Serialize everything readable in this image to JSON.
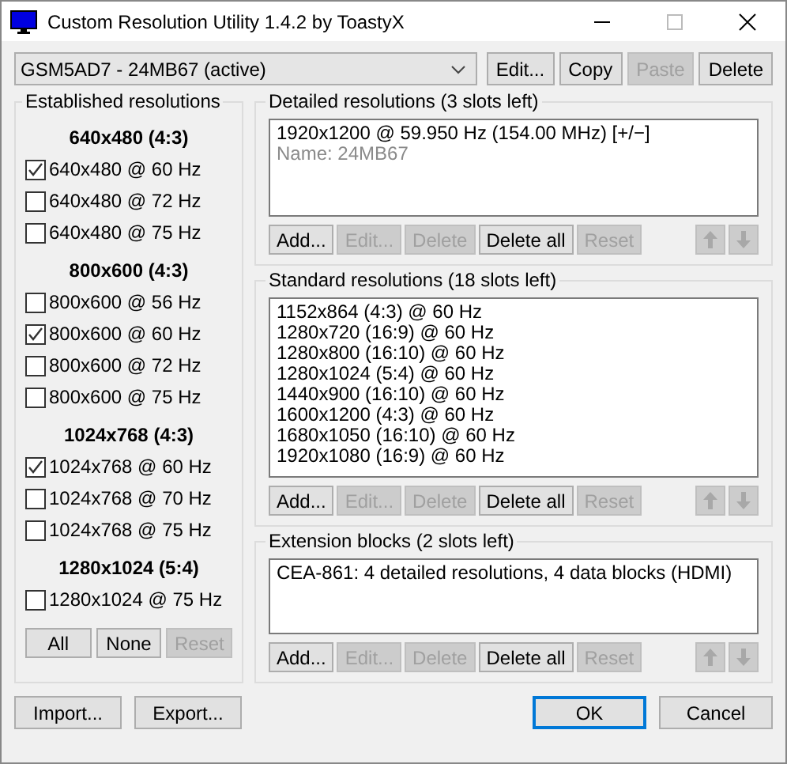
{
  "window": {
    "title": "Custom Resolution Utility 1.4.2 by ToastyX"
  },
  "device": {
    "value": "GSM5AD7 - 24MB67 (active)"
  },
  "device_buttons": [
    {
      "label": "Edit...",
      "disabled": false
    },
    {
      "label": "Copy",
      "disabled": false
    },
    {
      "label": "Paste",
      "disabled": true
    },
    {
      "label": "Delete",
      "disabled": false
    }
  ],
  "established": {
    "title": "Established resolutions",
    "groups": [
      {
        "heading": "640x480 (4:3)",
        "items": [
          {
            "label": "640x480 @ 60 Hz",
            "checked": true
          },
          {
            "label": "640x480 @ 72 Hz",
            "checked": false
          },
          {
            "label": "640x480 @ 75 Hz",
            "checked": false
          }
        ]
      },
      {
        "heading": "800x600 (4:3)",
        "items": [
          {
            "label": "800x600 @ 56 Hz",
            "checked": false
          },
          {
            "label": "800x600 @ 60 Hz",
            "checked": true
          },
          {
            "label": "800x600 @ 72 Hz",
            "checked": false
          },
          {
            "label": "800x600 @ 75 Hz",
            "checked": false
          }
        ]
      },
      {
        "heading": "1024x768 (4:3)",
        "items": [
          {
            "label": "1024x768 @ 60 Hz",
            "checked": true
          },
          {
            "label": "1024x768 @ 70 Hz",
            "checked": false
          },
          {
            "label": "1024x768 @ 75 Hz",
            "checked": false
          }
        ]
      },
      {
        "heading": "1280x1024 (5:4)",
        "items": [
          {
            "label": "1280x1024 @ 75 Hz",
            "checked": false
          }
        ]
      }
    ],
    "buttons": [
      {
        "label": "All",
        "disabled": false
      },
      {
        "label": "None",
        "disabled": false
      },
      {
        "label": "Reset",
        "disabled": true
      }
    ]
  },
  "sections": [
    {
      "title": "Detailed resolutions (3 slots left)",
      "lines": [
        {
          "text": "1920x1200 @ 59.950 Hz (154.00 MHz) [+/−]",
          "dim": false
        },
        {
          "text": "Name: 24MB67",
          "dim": true
        }
      ],
      "buttons": [
        {
          "label": "Add...",
          "disabled": false
        },
        {
          "label": "Edit...",
          "disabled": true
        },
        {
          "label": "Delete",
          "disabled": true
        },
        {
          "label": "Delete all",
          "disabled": false
        },
        {
          "label": "Reset",
          "disabled": true
        }
      ],
      "arrows": [
        {
          "kind": "up",
          "disabled": true
        },
        {
          "kind": "down",
          "disabled": true
        }
      ]
    },
    {
      "title": "Standard resolutions (18 slots left)",
      "lines": [
        {
          "text": "1152x864 (4:3) @ 60 Hz",
          "dim": false
        },
        {
          "text": "1280x720 (16:9) @ 60 Hz",
          "dim": false
        },
        {
          "text": "1280x800 (16:10) @ 60 Hz",
          "dim": false
        },
        {
          "text": "1280x1024 (5:4) @ 60 Hz",
          "dim": false
        },
        {
          "text": "1440x900 (16:10) @ 60 Hz",
          "dim": false
        },
        {
          "text": "1600x1200 (4:3) @ 60 Hz",
          "dim": false
        },
        {
          "text": "1680x1050 (16:10) @ 60 Hz",
          "dim": false
        },
        {
          "text": "1920x1080 (16:9) @ 60 Hz",
          "dim": false
        }
      ],
      "buttons": [
        {
          "label": "Add...",
          "disabled": false
        },
        {
          "label": "Edit...",
          "disabled": true
        },
        {
          "label": "Delete",
          "disabled": true
        },
        {
          "label": "Delete all",
          "disabled": false
        },
        {
          "label": "Reset",
          "disabled": true
        }
      ],
      "arrows": [
        {
          "kind": "up",
          "disabled": true
        },
        {
          "kind": "down",
          "disabled": true
        }
      ]
    },
    {
      "title": "Extension blocks (2 slots left)",
      "lines": [
        {
          "text": "CEA-861: 4 detailed resolutions, 4 data blocks (HDMI)",
          "dim": false
        }
      ],
      "buttons": [
        {
          "label": "Add...",
          "disabled": false
        },
        {
          "label": "Edit...",
          "disabled": true
        },
        {
          "label": "Delete",
          "disabled": true
        },
        {
          "label": "Delete all",
          "disabled": false
        },
        {
          "label": "Reset",
          "disabled": true
        }
      ],
      "arrows": [
        {
          "kind": "up",
          "disabled": true
        },
        {
          "kind": "down",
          "disabled": true
        }
      ]
    }
  ],
  "footer_left": [
    {
      "label": "Import...",
      "default": false
    },
    {
      "label": "Export...",
      "default": false
    }
  ],
  "footer_right": [
    {
      "label": "OK",
      "default": true
    },
    {
      "label": "Cancel",
      "default": false
    }
  ]
}
